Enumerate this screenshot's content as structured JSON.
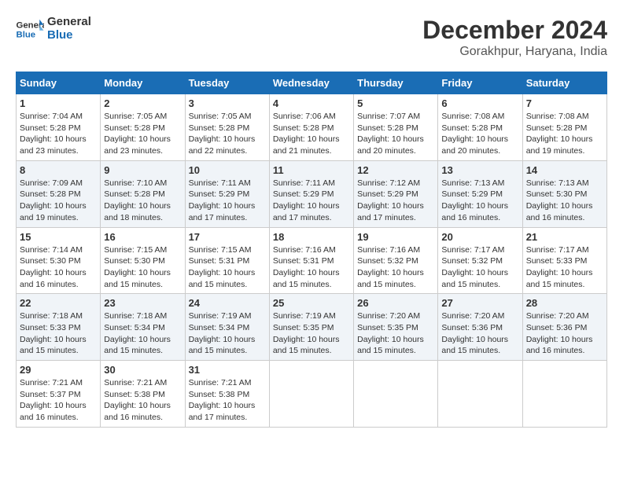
{
  "header": {
    "logo_line1": "General",
    "logo_line2": "Blue",
    "month_year": "December 2024",
    "location": "Gorakhpur, Haryana, India"
  },
  "weekdays": [
    "Sunday",
    "Monday",
    "Tuesday",
    "Wednesday",
    "Thursday",
    "Friday",
    "Saturday"
  ],
  "weeks": [
    [
      {
        "day": "1",
        "sunrise": "7:04 AM",
        "sunset": "5:28 PM",
        "daylight": "10 hours and 23 minutes."
      },
      {
        "day": "2",
        "sunrise": "7:05 AM",
        "sunset": "5:28 PM",
        "daylight": "10 hours and 23 minutes."
      },
      {
        "day": "3",
        "sunrise": "7:05 AM",
        "sunset": "5:28 PM",
        "daylight": "10 hours and 22 minutes."
      },
      {
        "day": "4",
        "sunrise": "7:06 AM",
        "sunset": "5:28 PM",
        "daylight": "10 hours and 21 minutes."
      },
      {
        "day": "5",
        "sunrise": "7:07 AM",
        "sunset": "5:28 PM",
        "daylight": "10 hours and 20 minutes."
      },
      {
        "day": "6",
        "sunrise": "7:08 AM",
        "sunset": "5:28 PM",
        "daylight": "10 hours and 20 minutes."
      },
      {
        "day": "7",
        "sunrise": "7:08 AM",
        "sunset": "5:28 PM",
        "daylight": "10 hours and 19 minutes."
      }
    ],
    [
      {
        "day": "8",
        "sunrise": "7:09 AM",
        "sunset": "5:28 PM",
        "daylight": "10 hours and 19 minutes."
      },
      {
        "day": "9",
        "sunrise": "7:10 AM",
        "sunset": "5:28 PM",
        "daylight": "10 hours and 18 minutes."
      },
      {
        "day": "10",
        "sunrise": "7:11 AM",
        "sunset": "5:29 PM",
        "daylight": "10 hours and 17 minutes."
      },
      {
        "day": "11",
        "sunrise": "7:11 AM",
        "sunset": "5:29 PM",
        "daylight": "10 hours and 17 minutes."
      },
      {
        "day": "12",
        "sunrise": "7:12 AM",
        "sunset": "5:29 PM",
        "daylight": "10 hours and 17 minutes."
      },
      {
        "day": "13",
        "sunrise": "7:13 AM",
        "sunset": "5:29 PM",
        "daylight": "10 hours and 16 minutes."
      },
      {
        "day": "14",
        "sunrise": "7:13 AM",
        "sunset": "5:30 PM",
        "daylight": "10 hours and 16 minutes."
      }
    ],
    [
      {
        "day": "15",
        "sunrise": "7:14 AM",
        "sunset": "5:30 PM",
        "daylight": "10 hours and 16 minutes."
      },
      {
        "day": "16",
        "sunrise": "7:15 AM",
        "sunset": "5:30 PM",
        "daylight": "10 hours and 15 minutes."
      },
      {
        "day": "17",
        "sunrise": "7:15 AM",
        "sunset": "5:31 PM",
        "daylight": "10 hours and 15 minutes."
      },
      {
        "day": "18",
        "sunrise": "7:16 AM",
        "sunset": "5:31 PM",
        "daylight": "10 hours and 15 minutes."
      },
      {
        "day": "19",
        "sunrise": "7:16 AM",
        "sunset": "5:32 PM",
        "daylight": "10 hours and 15 minutes."
      },
      {
        "day": "20",
        "sunrise": "7:17 AM",
        "sunset": "5:32 PM",
        "daylight": "10 hours and 15 minutes."
      },
      {
        "day": "21",
        "sunrise": "7:17 AM",
        "sunset": "5:33 PM",
        "daylight": "10 hours and 15 minutes."
      }
    ],
    [
      {
        "day": "22",
        "sunrise": "7:18 AM",
        "sunset": "5:33 PM",
        "daylight": "10 hours and 15 minutes."
      },
      {
        "day": "23",
        "sunrise": "7:18 AM",
        "sunset": "5:34 PM",
        "daylight": "10 hours and 15 minutes."
      },
      {
        "day": "24",
        "sunrise": "7:19 AM",
        "sunset": "5:34 PM",
        "daylight": "10 hours and 15 minutes."
      },
      {
        "day": "25",
        "sunrise": "7:19 AM",
        "sunset": "5:35 PM",
        "daylight": "10 hours and 15 minutes."
      },
      {
        "day": "26",
        "sunrise": "7:20 AM",
        "sunset": "5:35 PM",
        "daylight": "10 hours and 15 minutes."
      },
      {
        "day": "27",
        "sunrise": "7:20 AM",
        "sunset": "5:36 PM",
        "daylight": "10 hours and 15 minutes."
      },
      {
        "day": "28",
        "sunrise": "7:20 AM",
        "sunset": "5:36 PM",
        "daylight": "10 hours and 16 minutes."
      }
    ],
    [
      {
        "day": "29",
        "sunrise": "7:21 AM",
        "sunset": "5:37 PM",
        "daylight": "10 hours and 16 minutes."
      },
      {
        "day": "30",
        "sunrise": "7:21 AM",
        "sunset": "5:38 PM",
        "daylight": "10 hours and 16 minutes."
      },
      {
        "day": "31",
        "sunrise": "7:21 AM",
        "sunset": "5:38 PM",
        "daylight": "10 hours and 17 minutes."
      },
      null,
      null,
      null,
      null
    ]
  ]
}
